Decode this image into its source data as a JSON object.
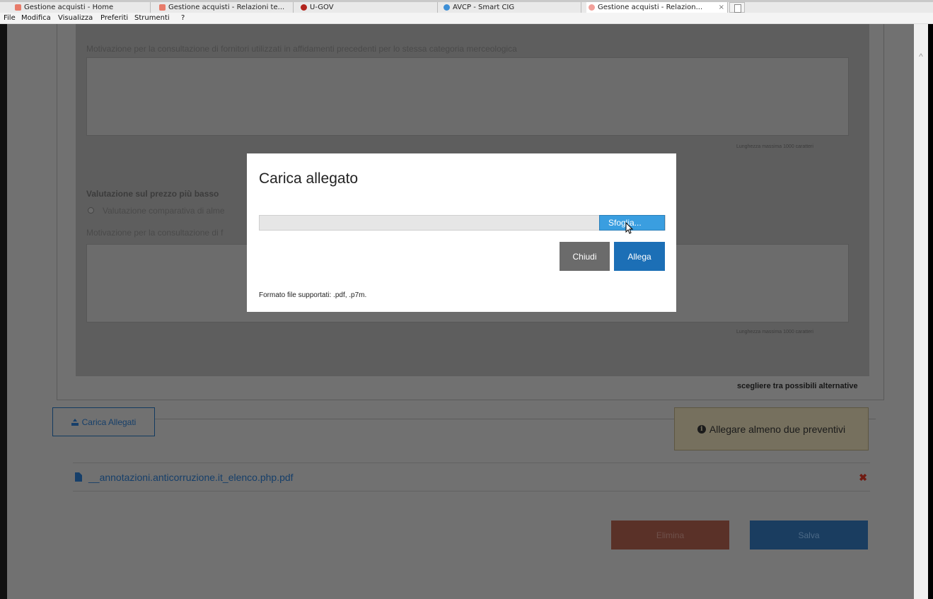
{
  "browser": {
    "tabs": [
      {
        "label": "Gestione acquisti - Home",
        "icon_color": "#e87b6a"
      },
      {
        "label": "Gestione acquisti - Relazioni te...",
        "icon_color": "#e87b6a"
      },
      {
        "label": "U-GOV",
        "icon_color": "#b2231c"
      },
      {
        "label": "AVCP - Smart CIG",
        "icon_color": "#3d8fd6"
      },
      {
        "label": "Gestione acquisti - Relazion...",
        "icon_color": "#f2a09a",
        "active": true,
        "close": "×"
      }
    ],
    "menu": [
      "File",
      "Modifica",
      "Visualizza",
      "Preferiti",
      "Strumenti",
      "?"
    ]
  },
  "form": {
    "motivation_label_1": "Motivazione per la consultazione di fornitori utilizzati in affidamenti precedenti per lo stessa categoria merceologica",
    "max_length_1": "Lunghezza massima 1000 caratteri",
    "price_section_title": "Valutazione sul prezzo più basso",
    "radio_option": "Valutazione comparativa di alme",
    "motivation_label_2": "Motivazione per la consultazione di f",
    "max_length_2": "Lunghezza massima 1000 caratteri",
    "alternatives_text": "scegliere tra possibili alternative"
  },
  "attachments": {
    "upload_button": "Carica Allegati",
    "warning": "Allegare almeno due preventivi",
    "files": [
      "__annotazioni.anticorruzione.it_elenco.php.pdf"
    ],
    "remove_symbol": "✖"
  },
  "actions": {
    "delete_label": "Elimina",
    "save_label": "Salva"
  },
  "modal": {
    "title": "Carica allegato",
    "browse_label": "Sfoglia...",
    "close_label": "Chiudi",
    "attach_label": "Allega",
    "supported_formats": "Formato file supportati: .pdf, .p7m."
  },
  "colors": {
    "primary": "#1c6fb6",
    "browse": "#3a9ee0",
    "close_button": "#6b6b6b",
    "danger": "#c0513a",
    "warning_bg": "#fcf8e3"
  }
}
